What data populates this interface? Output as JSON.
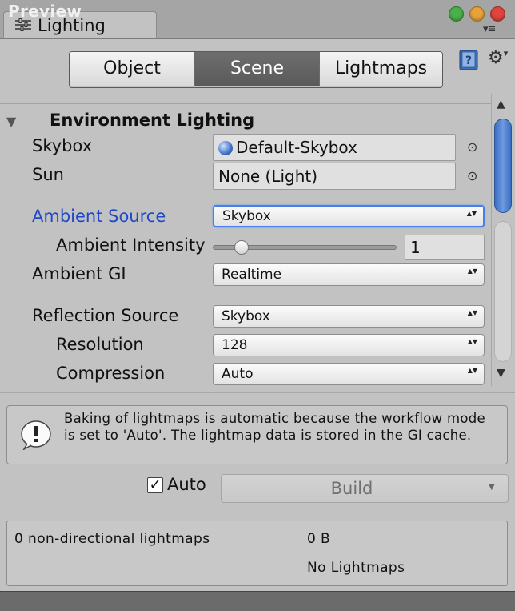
{
  "tab": {
    "title": "Lighting",
    "icon": "sliders-icon"
  },
  "window_controls": {
    "close": "#e0443e",
    "minimize": "#e8a23a",
    "maximize": "#48b14a"
  },
  "segments": [
    {
      "label": "Object",
      "active": false
    },
    {
      "label": "Scene",
      "active": true
    },
    {
      "label": "Lightmaps",
      "active": false
    }
  ],
  "section": {
    "title": "Environment Lighting"
  },
  "fields": {
    "skybox": {
      "label": "Skybox",
      "value": "Default-Skybox"
    },
    "sun": {
      "label": "Sun",
      "value": "None (Light)"
    },
    "ambient_source": {
      "label": "Ambient Source",
      "value": "Skybox"
    },
    "ambient_intensity": {
      "label": "Ambient Intensity",
      "value": "1",
      "slider_fraction": 0.125
    },
    "ambient_gi": {
      "label": "Ambient GI",
      "value": "Realtime"
    },
    "reflection_source": {
      "label": "Reflection Source",
      "value": "Skybox"
    },
    "resolution": {
      "label": "Resolution",
      "value": "128"
    },
    "compression": {
      "label": "Compression",
      "value": "Auto"
    }
  },
  "help": {
    "text": "Baking of lightmaps is automatic because the workflow mode is set to 'Auto'. The lightmap data is stored in the GI cache."
  },
  "auto": {
    "label": "Auto",
    "checked": true
  },
  "build": {
    "label": "Build"
  },
  "stats": {
    "lightmaps": "0 non-directional lightmaps",
    "size": "0 B",
    "status": "No Lightmaps"
  },
  "preview": {
    "label": "Preview"
  },
  "colors": {
    "accent": "#1f49c9",
    "scroll_thumb": "#4a7ed6"
  }
}
